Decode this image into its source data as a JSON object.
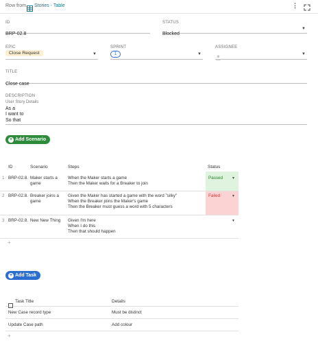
{
  "header": {
    "row_from": "Row from",
    "link_label": "Stories - Table",
    "menu_icon": "more-vertical-icon",
    "expand_icon": "expand-icon"
  },
  "fields": {
    "id_label": "ID",
    "id_value": "BRP-02.8",
    "status_label": "STATUS",
    "status_value": "Blocked",
    "epic_label": "EPIC",
    "epic_value": "Close Request",
    "sprint_label": "SPRINT",
    "sprint_value": "1",
    "assignee_label": "ASSIGNEE",
    "title_label": "TITLE",
    "title_value": "Close case",
    "description_label": "DESCRIPTION",
    "description_sub": "User Story Details",
    "description_lines": [
      "As a",
      "I want to",
      "So that"
    ]
  },
  "scenarios": {
    "add_label": "Add Scenario",
    "headers": [
      "ID",
      "Scenario",
      "Steps",
      "Status"
    ],
    "rows": [
      {
        "num": "1",
        "id": "BRP-02.8.",
        "scenario": [
          "Maker starts a",
          "game"
        ],
        "steps": [
          "When the Maker starts a game",
          "Then the Maker waits for a Breaker to join"
        ],
        "status": "Passed"
      },
      {
        "num": "2",
        "id": "BRP-02.8.",
        "scenario": [
          "Breaker joins a",
          "game"
        ],
        "steps": [
          "Given the Maker has started a game with the word \"silky\"",
          "When the Breaker joins the Maker's game",
          "Then the Breaker must guess a word with 5 characters"
        ],
        "status": "Failed"
      },
      {
        "num": "3",
        "id": "BRP-02.8.",
        "scenario": [
          "New New Thing",
          ""
        ],
        "steps": [
          "Given I'm here",
          "When I do this",
          "Then that should happen"
        ],
        "status": ""
      }
    ],
    "add_row": "+"
  },
  "tasks": {
    "add_label": "Add Task",
    "headers": [
      "Task Title",
      "Details"
    ],
    "rows": [
      {
        "title": "New Case record type",
        "details": "Must be distinct"
      },
      {
        "title": "Update Case path",
        "details": "Add colour"
      }
    ],
    "add_row": "+"
  },
  "colors": {
    "accent": "#0a7c8c",
    "passed_bg": "#dff3df",
    "failed_bg": "#fbd3d3",
    "epic_bg": "#fdf0d2",
    "green_button": "#2e8b3c",
    "blue_button": "#2d6fd1"
  }
}
